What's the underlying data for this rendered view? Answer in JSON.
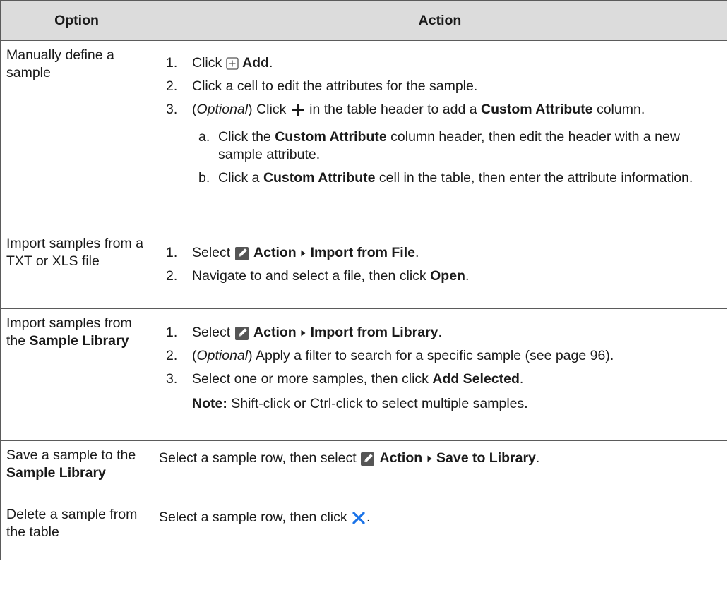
{
  "header": {
    "option": "Option",
    "action": "Action"
  },
  "rows": [
    {
      "option": "Manually define a sample",
      "steps": [
        {
          "n": "1.",
          "t1": "Click",
          "b1": "Add",
          "t2": "."
        },
        {
          "n": "2.",
          "t1": "Click a cell to edit the attributes for the sample."
        },
        {
          "n": "3.",
          "paren_l": "(",
          "optional": "Optional",
          "paren_r": ")",
          "t1": "Click",
          "t2": "in the table header to add a",
          "b1": "Custom Attribute",
          "t3": "column."
        }
      ],
      "sub": [
        {
          "n": "a.",
          "t1": "Click the",
          "b1": "Custom Attribute",
          "t2": "column header, then edit the header with a new sample attribute."
        },
        {
          "n": "b.",
          "t1": "Click a",
          "b1": "Custom Attribute",
          "t2": "cell in the table, then enter the attribute information."
        }
      ]
    },
    {
      "option": "Import samples from a TXT or XLS file",
      "steps": [
        {
          "n": "1.",
          "t1": "Select",
          "b1": "Action",
          "b2": "Import from File",
          "t2": "."
        },
        {
          "n": "2.",
          "t1": "Navigate to and select a file, then click",
          "b1": "Open",
          "t2": "."
        }
      ]
    },
    {
      "option_pre": "Import samples from the",
      "option_bold": "Sample Library",
      "steps": [
        {
          "n": "1.",
          "t1": "Select",
          "b1": "Action",
          "b2": "Import from Library",
          "t2": "."
        },
        {
          "n": "2.",
          "paren_l": "(",
          "optional": "Optional",
          "paren_r": ")",
          "t1": "Apply a filter to search for a specific sample (see page 96)."
        },
        {
          "n": "3.",
          "t1": "Select one or more samples, then click",
          "b1": "Add Selected",
          "t2": "."
        }
      ],
      "note_label": "Note:",
      "note_text": "Shift-click or Ctrl-click to select multiple samples."
    },
    {
      "option_pre": "Save a sample to the",
      "option_bold": "Sample Library",
      "t1": "Select a sample row, then select",
      "b1": "Action",
      "b2": "Save to Library",
      "t2": "."
    },
    {
      "option": "Delete a sample from the table",
      "t1": "Select a sample row, then click",
      "t2": "."
    }
  ],
  "icons": {
    "add": "add-box-icon",
    "plus": "plus-icon",
    "action": "edit-action-icon",
    "arrow": "submenu-arrow-icon",
    "delete": "delete-x-icon"
  },
  "colors": {
    "header_bg": "#dcdcdc",
    "delete_icon": "#1a73e8",
    "border": "#5b5b5b"
  }
}
